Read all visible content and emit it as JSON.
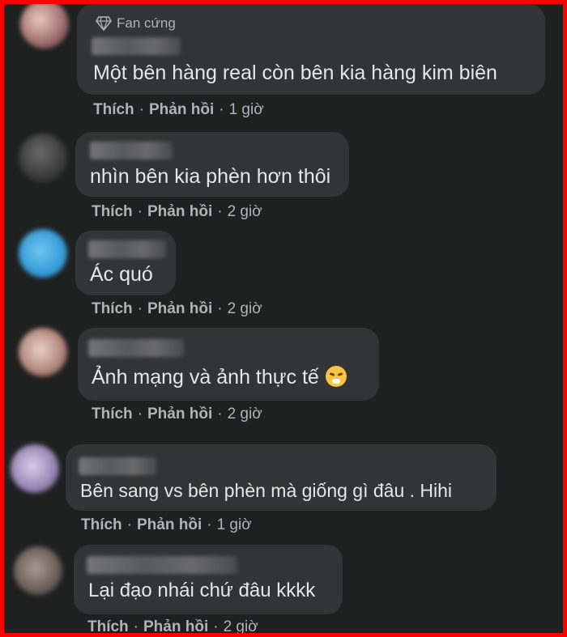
{
  "badge": {
    "label": "Fan cứng",
    "icon": "diamond-icon"
  },
  "actions": {
    "like": "Thích",
    "reply": "Phản hồi",
    "sep": "·"
  },
  "comments": [
    {
      "text": "Một bên hàng real còn bên kia hàng kim biên",
      "time": "1 giờ"
    },
    {
      "text": "nhìn bên kia phèn hơn thôi",
      "time": "2 giờ"
    },
    {
      "text": "Ác quó",
      "time": "2 giờ"
    },
    {
      "text": "Ảnh mạng và ảnh thực tế",
      "time": "2 giờ",
      "emoji": "persevering-face-emoji"
    },
    {
      "text": "Bên sang vs bên phèn mà giống gì đâu . Hihi",
      "time": "1 giờ"
    },
    {
      "text": "Lại đạo nhái chứ đâu kkkk",
      "time": "2 giờ"
    }
  ],
  "colors": {
    "border": "#ff0000",
    "background": "#1f2020",
    "bubble": "#333436",
    "text": "#e4e6eb",
    "meta": "#b0b3b8"
  }
}
